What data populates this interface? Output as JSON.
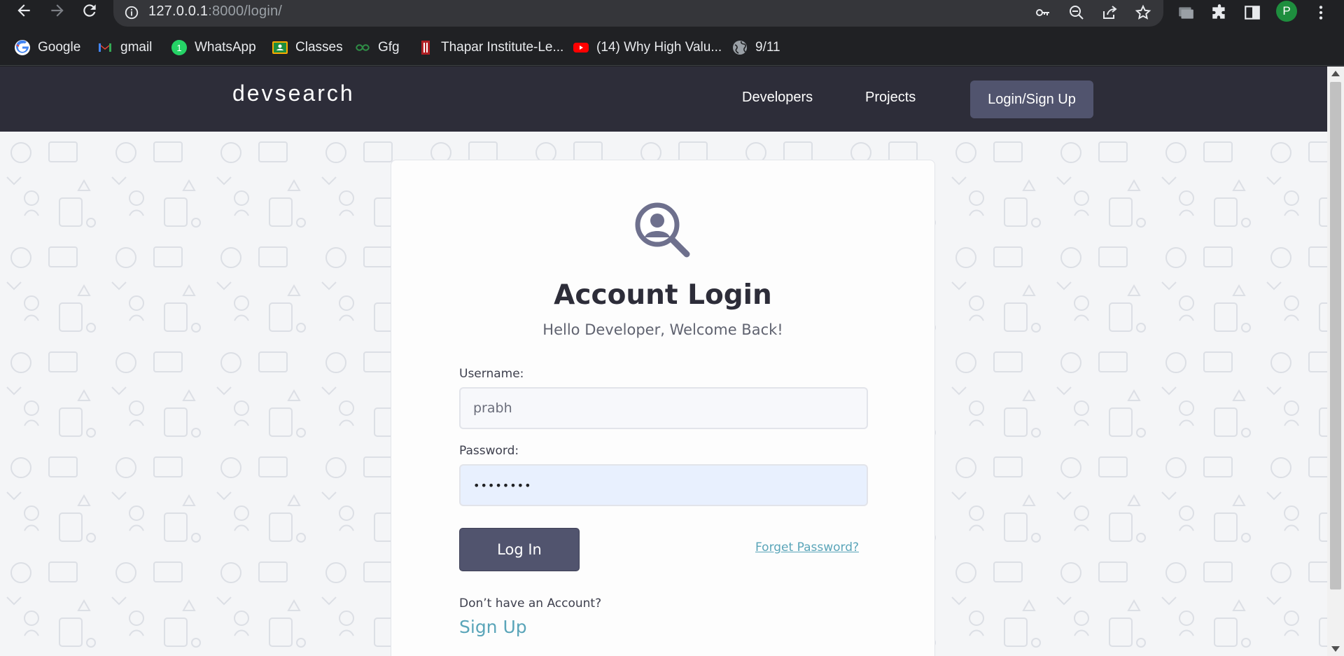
{
  "browser": {
    "url_host": "127.0.0.1",
    "url_path": ":8000/login/",
    "profile_initial": "P",
    "bookmarks": [
      {
        "label": "Google",
        "icon": "google-icon"
      },
      {
        "label": "gmail",
        "icon": "gmail-icon"
      },
      {
        "label": "WhatsApp",
        "icon": "whatsapp-icon"
      },
      {
        "label": "Classes",
        "icon": "classroom-icon"
      },
      {
        "label": "Gfg",
        "icon": "gfg-icon"
      },
      {
        "label": "Thapar Institute-Le...",
        "icon": "thapar-icon"
      },
      {
        "label": "(14) Why High Valu...",
        "icon": "youtube-icon"
      },
      {
        "label": "9/11",
        "icon": "globe-icon"
      }
    ]
  },
  "site": {
    "logo": "devsearch",
    "nav": {
      "developers": "Developers",
      "projects": "Projects",
      "login": "Login/Sign Up"
    }
  },
  "login_card": {
    "title": "Account Login",
    "subtitle": "Hello Developer, Welcome Back!",
    "username_label": "Username:",
    "username_value": "prabh",
    "password_label": "Password:",
    "password_value": "••••••••",
    "submit_label": "Log In",
    "forget_label": "Forget Password?",
    "no_account_text": "Don’t have an Account?",
    "signup_label": "Sign Up"
  },
  "colors": {
    "header_bg": "#2d2d39",
    "accent": "#51546e",
    "link": "#5aa5b9"
  }
}
